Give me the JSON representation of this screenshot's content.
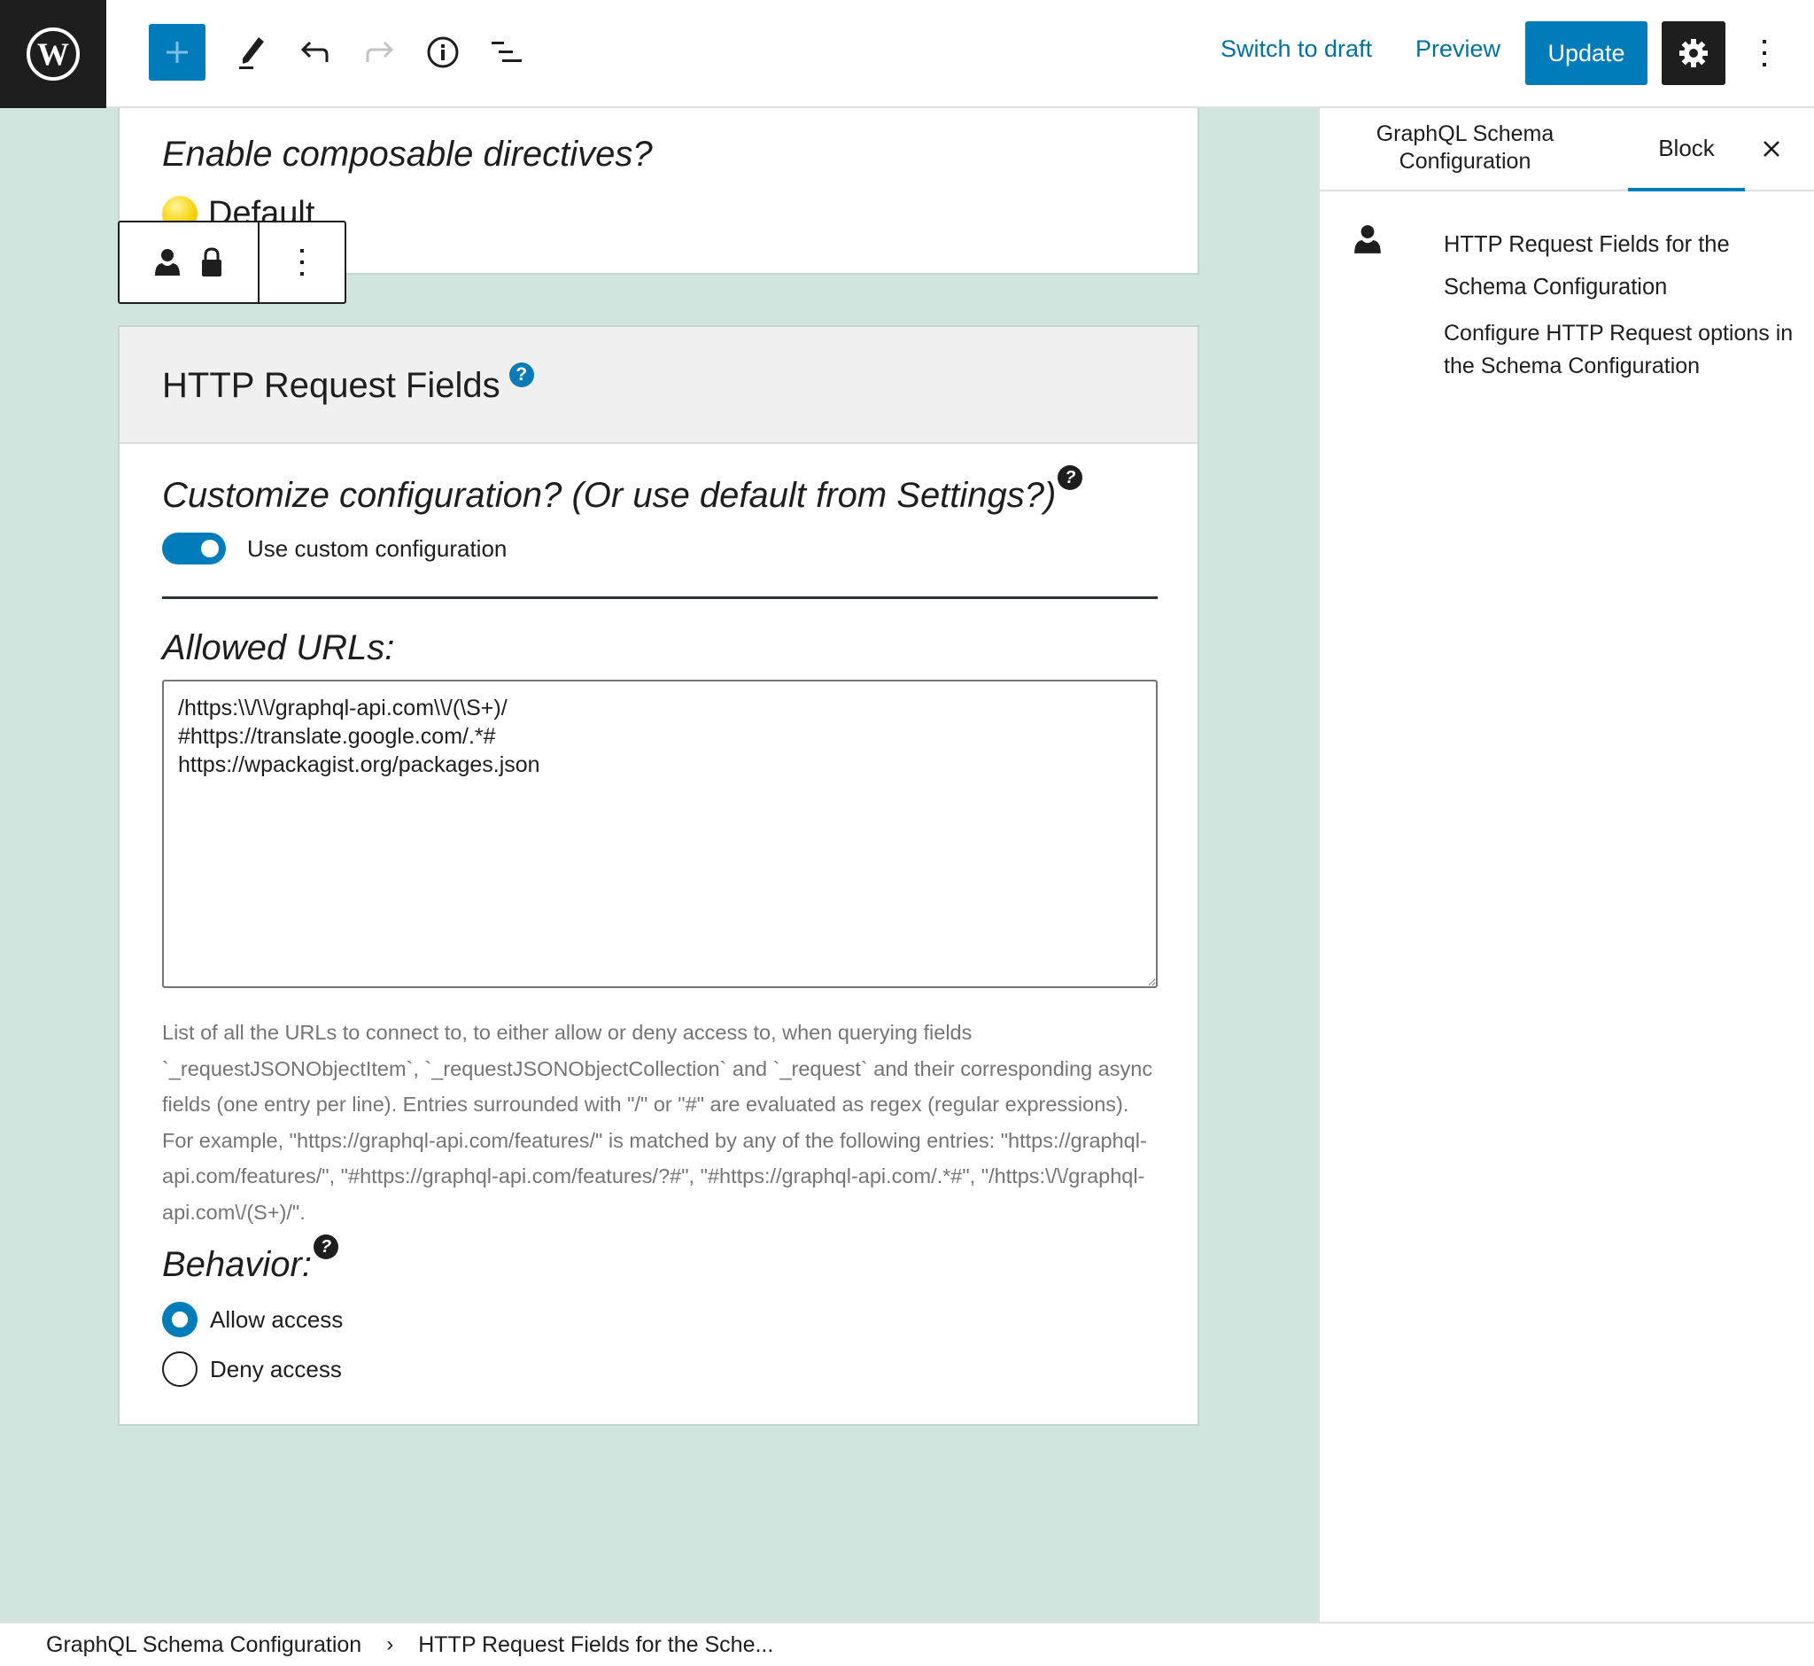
{
  "topbar": {
    "logo": "wordpress-logo",
    "tools": [
      {
        "name": "add-block",
        "icon": "plus-icon"
      },
      {
        "name": "tools",
        "icon": "pencil-icon"
      },
      {
        "name": "undo",
        "icon": "undo-icon"
      },
      {
        "name": "redo",
        "icon": "redo-icon",
        "disabled": true
      },
      {
        "name": "details",
        "icon": "info-icon"
      },
      {
        "name": "list-view",
        "icon": "list-view-icon"
      }
    ],
    "switch_to_draft": "Switch to draft",
    "preview": "Preview",
    "update": "Update",
    "settings_icon": "gear-icon",
    "more_icon": "more-vertical-icon",
    "accent": "#007cba"
  },
  "editor": {
    "prev_block": {
      "question": "Enable composable directives?",
      "value_label": "Default"
    },
    "block_toolbar": {
      "icons": [
        "user-icon",
        "lock-icon"
      ],
      "options_icon": "more-vertical-icon"
    },
    "block": {
      "title": "HTTP Request Fields",
      "help": "?",
      "customize_question": "Customize configuration? (Or use default from Settings?)",
      "customize_help": "?",
      "toggle_label": "Use custom configuration",
      "toggle_on": true,
      "allowed_label": "Allowed URLs:",
      "allowed_urls": "/https:\\\\/\\\\/graphql-api.com\\\\/(\\S+)/\n#https://translate.google.com/.*#\nhttps://wpackagist.org/packages.json",
      "description": "List of all the URLs to connect to, to either allow or deny access to, when querying fields `_requestJSONObjectItem`, `_requestJSONObjectCollection` and `_request` and their corresponding async fields (one entry per line). Entries surrounded with \"/\" or \"#\" are evaluated as regex (regular expressions). For example, \"https://graphql-api.com/features/\" is matched by any of the following entries: \"https://graphql-api.com/features/\", \"#https://graphql-api.com/features/?#\", \"#https://graphql-api.com/.*#\", \"/https:\\/\\/graphql-api.com\\/(S+)/\".",
      "behavior_label": "Behavior:",
      "behavior_help": "?",
      "behavior_options": [
        {
          "label": "Allow access",
          "checked": true
        },
        {
          "label": "Deny access",
          "checked": false
        }
      ]
    }
  },
  "sidebar": {
    "tabs": [
      {
        "label": "GraphQL Schema Configuration",
        "active": false
      },
      {
        "label": "Block",
        "active": true
      }
    ],
    "close_icon": "close-icon",
    "block_card": {
      "icon": "user-icon",
      "title": "HTTP Request Fields for the Schema Configuration",
      "description": "Configure HTTP Request options in the Schema Configuration"
    }
  },
  "breadcrumb": {
    "items": [
      "GraphQL Schema Configuration",
      "HTTP Request Fields for the Sche..."
    ],
    "separator": "›"
  }
}
